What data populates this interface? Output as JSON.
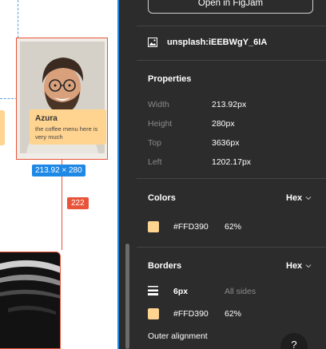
{
  "header": {
    "open_button": "Open in FigJam"
  },
  "layer": {
    "name": "unsplash:iEEBWgY_6IA",
    "icon": "image-icon"
  },
  "properties": {
    "title": "Properties",
    "rows": [
      {
        "label": "Width",
        "value": "213.92px"
      },
      {
        "label": "Height",
        "value": "280px"
      },
      {
        "label": "Top",
        "value": "3636px"
      },
      {
        "label": "Left",
        "value": "1202.17px"
      }
    ]
  },
  "colors": {
    "title": "Colors",
    "format": "Hex",
    "swatch": {
      "color": "#FFD390",
      "hex": "#FFD390",
      "opacity": "62%"
    }
  },
  "borders": {
    "title": "Borders",
    "format": "Hex",
    "weight": "6px",
    "sides": "All sides",
    "swatch": {
      "color": "#FFD390",
      "hex": "#FFD390",
      "opacity": "62%"
    },
    "alignment_label": "Outer alignment"
  },
  "canvas": {
    "card_title": "Azura",
    "card_text": "the coffee menu here is very much",
    "dimension_badge": "213.92 × 280",
    "distance_badge": "222"
  },
  "help": {
    "label": "?"
  },
  "theme": {
    "panel_bg": "#2c2c2c",
    "selection": "#1e88e5",
    "measure": "#e8543a",
    "accent": "#FFD390"
  }
}
